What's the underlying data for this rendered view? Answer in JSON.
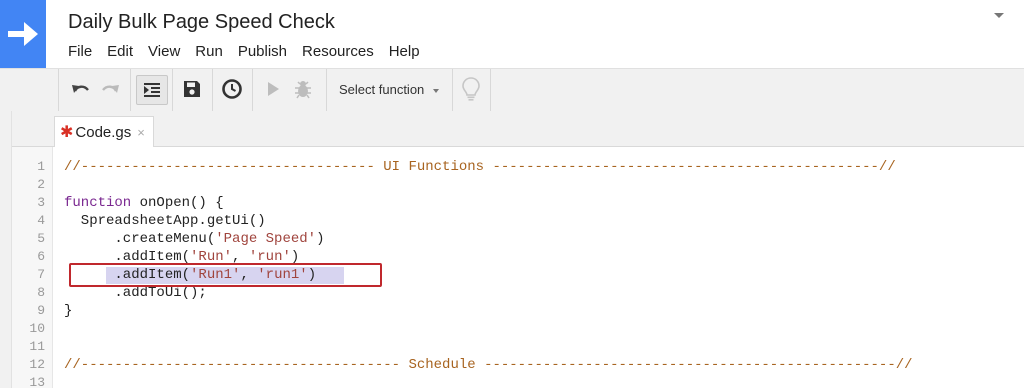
{
  "app": {
    "title": "Daily Bulk Page Speed Check",
    "brand_color": "#4285f4",
    "logo_icon": "arrow-right-icon"
  },
  "menu": {
    "items": [
      "File",
      "Edit",
      "View",
      "Run",
      "Publish",
      "Resources",
      "Help"
    ]
  },
  "toolbar": {
    "select_function_label": "Select function",
    "icons": [
      "undo-icon",
      "redo-icon",
      "indent-icon",
      "save-icon",
      "triggers-clock-icon",
      "run-play-icon",
      "debug-bug-icon",
      "lightbulb-icon"
    ]
  },
  "tab": {
    "name": "Code.gs",
    "modified_marker": "✱",
    "close_glyph": "×"
  },
  "editor": {
    "line_numbers": [
      "1",
      "2",
      "3",
      "4",
      "5",
      "6",
      "7",
      "8",
      "9",
      "10",
      "11",
      "12",
      "13"
    ],
    "lines": {
      "l1": "//----------------------------------- UI Functions ----------------------------------------------//",
      "l3_kw": "function",
      "l3_rest": " onOpen() {",
      "l4": "  SpreadsheetApp.getUi()",
      "l5_a": "      .createMenu(",
      "l5_s": "'Page Speed'",
      "l5_b": ")",
      "l6_a": "      .addItem(",
      "l6_s1": "'Run'",
      "l6_c": ", ",
      "l6_s2": "'run'",
      "l6_b": ")",
      "l7_a": "      .addItem(",
      "l7_s1": "'Run1'",
      "l7_c": ", ",
      "l7_s2": "'run1'",
      "l7_b": ")",
      "l8": "      .addToUi();",
      "l9": "}",
      "l12": "//-------------------------------------- Schedule -------------------------------------------------//"
    },
    "highlight_color": "#d7d4f0",
    "annotation_color": "#c0282d"
  }
}
